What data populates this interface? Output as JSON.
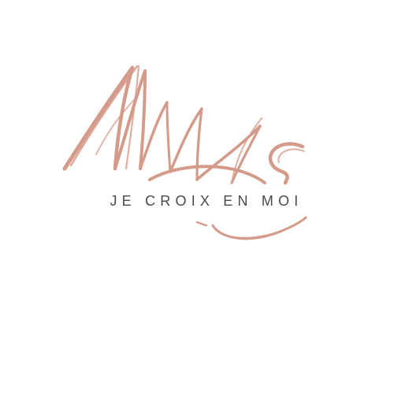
{
  "logo": {
    "signature_icon": "handwritten-signature-logo",
    "accent_color": "#d49a8a",
    "tagline": "JE CROIX EN MOI"
  }
}
